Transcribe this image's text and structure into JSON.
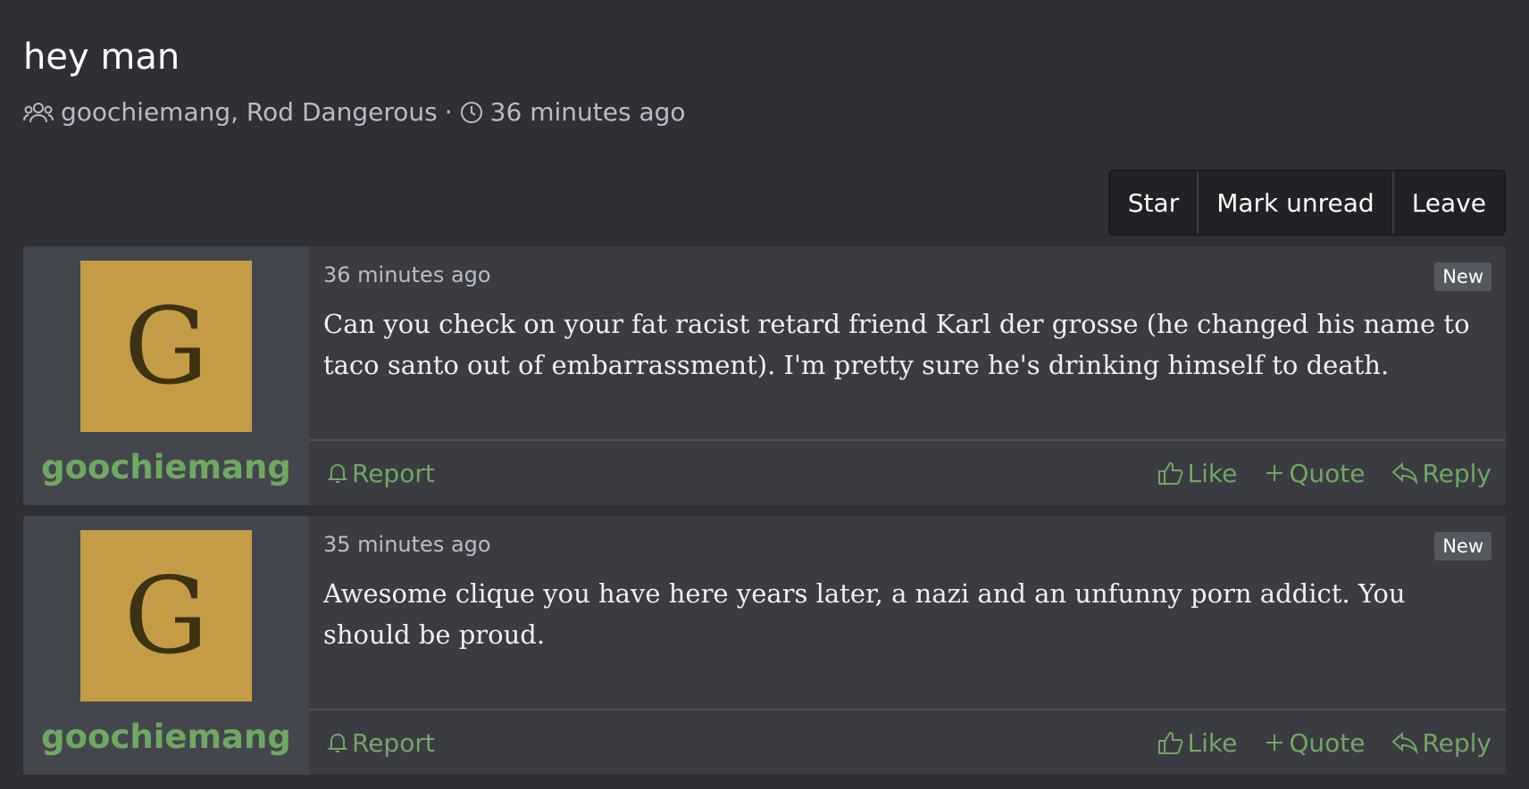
{
  "thread": {
    "title": "hey man",
    "participants": "goochiemang, Rod Dangerous",
    "separator": "·",
    "time": "36 minutes ago"
  },
  "actions": {
    "star": "Star",
    "mark_unread": "Mark unread",
    "leave": "Leave"
  },
  "messages": [
    {
      "avatar_letter": "G",
      "username": "goochiemang",
      "time": "36 minutes ago",
      "badge": "New",
      "text": "Can you check on your fat racist retard friend Karl der grosse (he changed his name to taco santo out of embarrassment). I'm pretty sure he's drinking himself to death.",
      "report": "Report",
      "like": "Like",
      "quote": "Quote",
      "reply": "Reply"
    },
    {
      "avatar_letter": "G",
      "username": "goochiemang",
      "time": "35 minutes ago",
      "badge": "New",
      "text": "Awesome clique you have here years later, a nazi and an unfunny porn addict. You should be proud.",
      "report": "Report",
      "like": "Like",
      "quote": "Quote",
      "reply": "Reply"
    }
  ],
  "colors": {
    "background": "#2e3036",
    "avatar": "#c49c46",
    "link_green": "#6fa862"
  },
  "icons": {
    "participants": "users-icon",
    "time": "clock-icon",
    "report": "bell-icon",
    "like": "thumbs-up-icon",
    "quote": "plus-icon",
    "reply": "reply-icon"
  }
}
